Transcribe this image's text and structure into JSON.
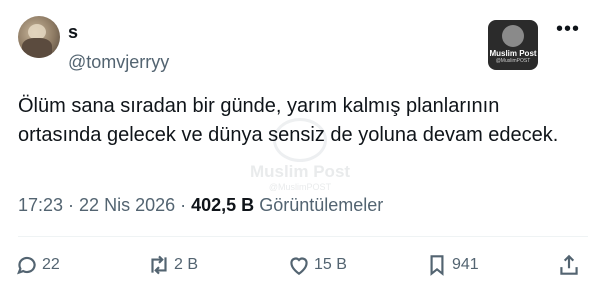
{
  "author": {
    "name": "s",
    "handle": "@tomvjerryy"
  },
  "badge": {
    "title": "Muslim Post",
    "sub": "@MuslimPOST"
  },
  "tweet": {
    "text": "Ölüm sana sıradan bir günde, yarım kalmış planlarının ortasında gelecek ve dünya sensiz de yoluna devam edecek."
  },
  "watermark": {
    "title": "Muslim Post",
    "sub": "@MuslimPOST"
  },
  "meta": {
    "time": "17:23",
    "sep1": " · ",
    "date": "22 Nis 2026",
    "sep2": " · ",
    "views": "402,5 B",
    "views_label": "Görüntülemeler"
  },
  "actions": {
    "replies": "22",
    "reposts": "2 B",
    "likes": "15 B",
    "bookmarks": "941"
  },
  "colors": {
    "text": "#0f1419",
    "muted": "#536471",
    "divider": "#eff3f4"
  }
}
